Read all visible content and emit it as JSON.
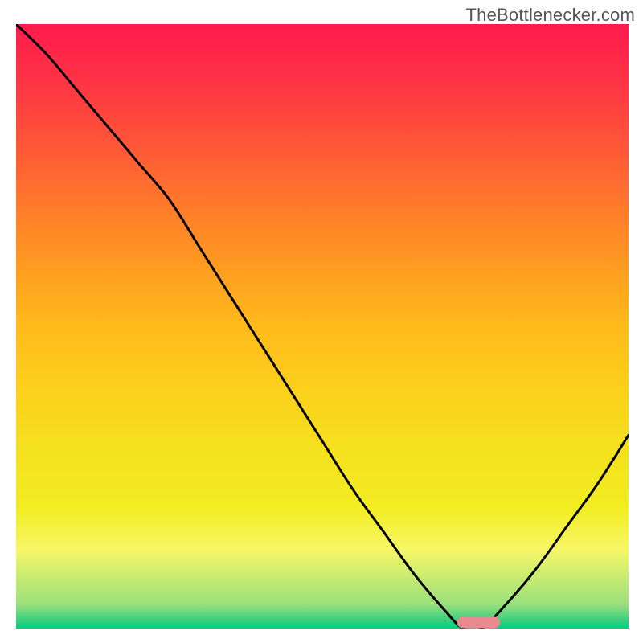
{
  "watermark": "TheBottlenecker.com",
  "chart_data": {
    "type": "line",
    "title": "",
    "xlabel": "",
    "ylabel": "",
    "xlim": [
      0,
      100
    ],
    "ylim": [
      0,
      100
    ],
    "x": [
      0,
      5,
      10,
      15,
      20,
      25,
      30,
      35,
      40,
      45,
      50,
      55,
      60,
      65,
      70,
      73,
      76,
      80,
      85,
      90,
      95,
      100
    ],
    "values": [
      100,
      95,
      89,
      83,
      77,
      71,
      63,
      55,
      47,
      39,
      31,
      23,
      16,
      9,
      3,
      0,
      0,
      4,
      10,
      17,
      24,
      32
    ],
    "marker": {
      "x_start": 72,
      "x_end": 79,
      "y": 1
    },
    "background_gradient_stops": [
      {
        "offset": 0.0,
        "color": "#ff1a4e"
      },
      {
        "offset": 0.1,
        "color": "#ff3544"
      },
      {
        "offset": 0.2,
        "color": "#ff5637"
      },
      {
        "offset": 0.3,
        "color": "#ff7a2b"
      },
      {
        "offset": 0.4,
        "color": "#ff9b21"
      },
      {
        "offset": 0.5,
        "color": "#ffba1b"
      },
      {
        "offset": 0.6,
        "color": "#fccf1b"
      },
      {
        "offset": 0.7,
        "color": "#f5e01e"
      },
      {
        "offset": 0.8,
        "color": "#f2ed21"
      },
      {
        "offset": 0.87,
        "color": "#f6f667"
      },
      {
        "offset": 0.96,
        "color": "#9ae07c"
      },
      {
        "offset": 0.985,
        "color": "#3fcf7e"
      },
      {
        "offset": 1.0,
        "color": "#00d07e"
      }
    ],
    "curve_color": "#000000",
    "marker_color": "#e88a8e"
  }
}
